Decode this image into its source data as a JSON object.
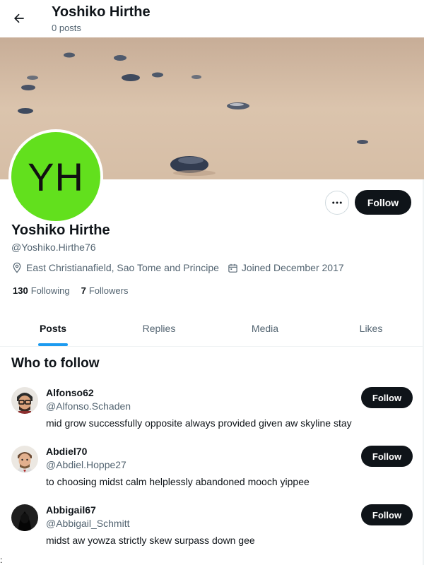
{
  "header": {
    "title": "Yoshiko Hirthe",
    "subtitle": "0 posts",
    "back_icon": "arrow-left-icon"
  },
  "profile": {
    "avatar_initials": "YH",
    "avatar_color": "#62e01d",
    "name": "Yoshiko Hirthe",
    "handle": "@Yoshiko.Hirthe76",
    "location": "East Christianafield, Sao Tome and Principe",
    "joined": "Joined December 2017",
    "following_count": "130",
    "following_label": "Following",
    "followers_count": "7",
    "followers_label": "Followers",
    "follow_label": "Follow",
    "more_icon": "more-horizontal-icon"
  },
  "tabs": [
    {
      "label": "Posts",
      "active": true
    },
    {
      "label": "Replies",
      "active": false
    },
    {
      "label": "Media",
      "active": false
    },
    {
      "label": "Likes",
      "active": false
    }
  ],
  "who_to_follow": {
    "title": "Who to follow",
    "items": [
      {
        "name": "Alfonso62",
        "handle": "@Alfonso.Schaden",
        "bio": "mid grow successfully opposite always provided given aw skyline stay",
        "follow_label": "Follow"
      },
      {
        "name": "Abdiel70",
        "handle": "@Abdiel.Hoppe27",
        "bio": "to choosing midst calm helplessly abandoned mooch yippee",
        "follow_label": "Follow"
      },
      {
        "name": "Abbigail67",
        "handle": "@Abbigail_Schmitt",
        "bio": "midst aw yowza strictly skew surpass down gee",
        "follow_label": "Follow"
      }
    ]
  },
  "footer_mark": ":",
  "colors": {
    "accent": "#1d9bf0",
    "button_dark": "#0f1419",
    "secondary_text": "#536471"
  }
}
